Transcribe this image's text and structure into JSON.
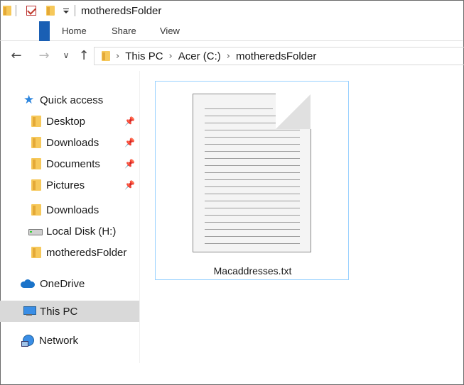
{
  "window": {
    "title": "motheredsFolder"
  },
  "ribbon": {
    "tabs": [
      "Home",
      "Share",
      "View"
    ]
  },
  "address": {
    "crumbs": [
      "This PC",
      "Acer (C:)",
      "motheredsFolder"
    ]
  },
  "navpane": {
    "quick_access": "Quick access",
    "pinned": [
      {
        "label": "Desktop",
        "icon": "desktop-folder-icon"
      },
      {
        "label": "Downloads",
        "icon": "downloads-folder-icon"
      },
      {
        "label": "Documents",
        "icon": "documents-folder-icon"
      },
      {
        "label": "Pictures",
        "icon": "pictures-folder-icon"
      }
    ],
    "recent": [
      {
        "label": "Downloads",
        "icon": "folder-icon"
      },
      {
        "label": "Local Disk (H:)",
        "icon": "disk-icon"
      },
      {
        "label": "motheredsFolder",
        "icon": "folder-icon"
      }
    ],
    "onedrive": "OneDrive",
    "this_pc": "This PC",
    "network": "Network"
  },
  "content": {
    "files": [
      {
        "name": "Macaddresses.txt",
        "icon": "text-document-icon"
      }
    ]
  },
  "colors": {
    "accent": "#1a5fb4",
    "selection_border": "#99d1ff",
    "selected_nav": "#d9d9d9",
    "folder": "#f6c85a"
  }
}
